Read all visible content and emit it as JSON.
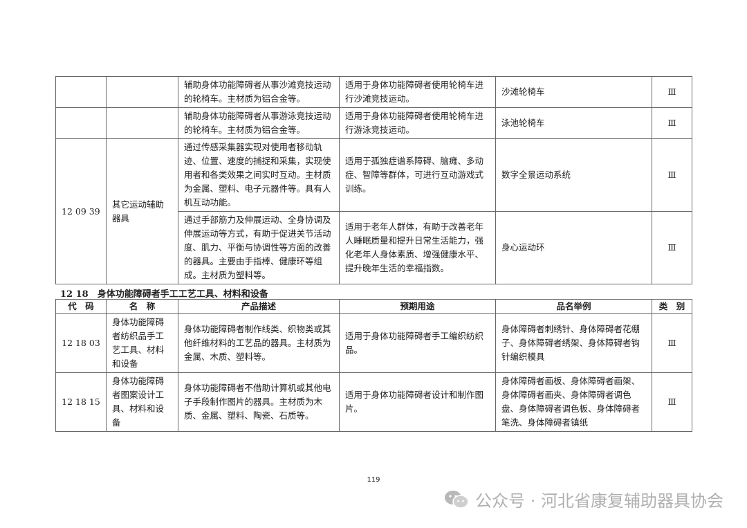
{
  "table1": {
    "rows": [
      {
        "desc": "辅助身体功能障碍者从事沙滩竞技运动的轮椅车。主材质为铝合金等。",
        "use": "适用于身体功能障碍者使用轮椅车进行沙滩竞技运动。",
        "example": "沙滩轮椅车",
        "category": "Ⅲ"
      },
      {
        "desc": "辅助身体功能障碍者从事游泳竞技运动的轮椅车。主材质为铝合金等。",
        "use": "适用于身体功能障碍者使用轮椅车进行游泳竞技运动。",
        "example": "泳池轮椅车",
        "category": "Ⅲ"
      },
      {
        "desc": "通过传感采集器实现对使用者移动轨迹、位置、速度的捕捉和采集，实现使用者和各类效果之间实时互动。主材质为金属、塑料、电子元器件等。具有人机互动功能。",
        "use": "适用于孤独症谱系障碍、脑瘫、多动症、智障等群体，可进行互动游戏式训练。",
        "example": "数字全景运动系统",
        "category": "Ⅲ"
      },
      {
        "desc": "通过手部筋力及伸展运动、全身协调及伸展运动等方式，有助于促进关节活动度、肌力、平衡与协调性等方面的改善的器具。主要由手指棒、健康环等组成。主材质为塑料等。",
        "use": "适用于老年人群体，有助于改善老年人睡眠质量和提升日常生活能力，强化老年人身体素质、增强健康水平、提升晚年生活的幸福指数。",
        "example": "身心运动环",
        "category": "Ⅲ"
      }
    ],
    "group_code": "12 09 39",
    "group_name": "其它运动辅助器具"
  },
  "section": {
    "title": "12 18　身体功能障碍者手工工艺工具、材料和设备"
  },
  "table2": {
    "headers": {
      "code": "代　码",
      "name": "名　称",
      "desc": "产品描述",
      "use": "预期用途",
      "example": "品名举例",
      "category": "类　别"
    },
    "rows": [
      {
        "code": "12 18 03",
        "name": "身体功能障碍者纺织品手工艺工具、材料和设备",
        "desc": "身体功能障碍者制作线类、织物类或其他纤维材料的工艺品的器具。主材质为金属、木质、塑料等。",
        "use": "适用于身体功能障碍者手工编织纺织品。",
        "example": "身体障碍者刺绣针、身体障碍者花绷子、身体障碍者绣架、身体障碍者钩针编织模具",
        "category": "Ⅲ"
      },
      {
        "code": "12 18 15",
        "name": "身体功能障碍者图案设计工具、材料和设备",
        "desc": "身体功能障碍者不借助计算机或其他电子手段制作图片的器具。主材质为木质、金属、塑料、陶瓷、石质等。",
        "use": "适用于身体功能障碍者设计和制作图片。",
        "example": "身体障碍者画板、身体障碍者画架、身体障碍者画夹、身体障碍者调色盘、身体障碍者调色板、身体障碍者笔洗、身体障碍者镇纸",
        "category": "Ⅲ"
      }
    ]
  },
  "footer": {
    "page_number": "119",
    "watermark": "公众号 · 河北省康复辅助器具协会",
    "watermark_icon": "wechat-icon"
  }
}
